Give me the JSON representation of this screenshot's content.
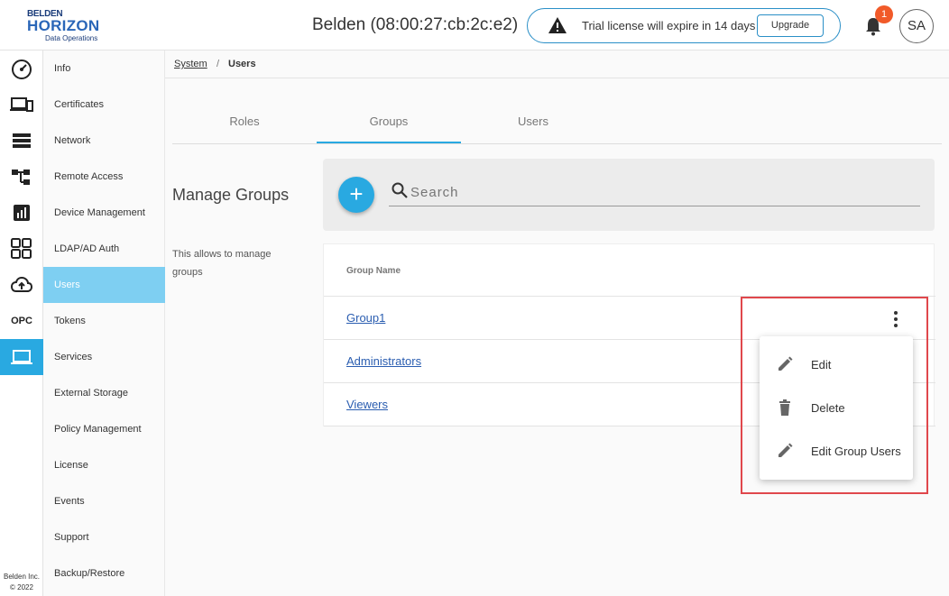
{
  "header": {
    "logo": {
      "line1": "BELDEN",
      "line2": "HORIZON",
      "line3": "Data Operations"
    },
    "device_title": "Belden (08:00:27:cb:2c:e2)",
    "trial_text": "Trial license will expire in 14 days",
    "upgrade_label": "Upgrade",
    "notification_count": "1",
    "avatar_initials": "SA"
  },
  "rail": {
    "icons": [
      "dashboard-icon",
      "devices-icon",
      "list-icon",
      "topology-icon",
      "chart-icon",
      "apps-grid-icon",
      "cloud-upload-icon",
      "opc-icon",
      "laptop-icon"
    ],
    "opc_label": "OPC",
    "footer_line1": "Belden Inc.",
    "footer_line2": "© 2022",
    "active_color": "#29a9e1"
  },
  "submenu": {
    "items": [
      {
        "label": "Info"
      },
      {
        "label": "Certificates"
      },
      {
        "label": "Network"
      },
      {
        "label": "Remote Access"
      },
      {
        "label": "Device Management"
      },
      {
        "label": "LDAP/AD Auth"
      },
      {
        "label": "Users"
      },
      {
        "label": "Tokens"
      },
      {
        "label": "Services"
      },
      {
        "label": "External Storage"
      },
      {
        "label": "Policy Management"
      },
      {
        "label": "License"
      },
      {
        "label": "Events"
      },
      {
        "label": "Support"
      },
      {
        "label": "Backup/Restore"
      }
    ],
    "active_label": "Users"
  },
  "breadcrumb": {
    "parent": "System",
    "separator": "/",
    "current": "Users"
  },
  "tabs": [
    {
      "label": "Roles"
    },
    {
      "label": "Groups"
    },
    {
      "label": "Users"
    }
  ],
  "active_tab": "Groups",
  "main": {
    "title": "Manage Groups",
    "description": "This allows to manage groups",
    "add_button_label": "+",
    "search_placeholder": "Search"
  },
  "table": {
    "column_header": "Group Name",
    "rows": [
      {
        "name": "Group1"
      },
      {
        "name": "Administrators"
      },
      {
        "name": "Viewers"
      }
    ]
  },
  "context_menu": {
    "items": [
      {
        "label": "Edit",
        "icon": "pencil-icon"
      },
      {
        "label": "Delete",
        "icon": "trash-icon"
      },
      {
        "label": "Edit Group Users",
        "icon": "pencil-icon"
      }
    ]
  },
  "colors": {
    "accent": "#29a9e1",
    "highlight_border": "#e0474c",
    "badge": "#f15a29",
    "link": "#2a5db0"
  }
}
